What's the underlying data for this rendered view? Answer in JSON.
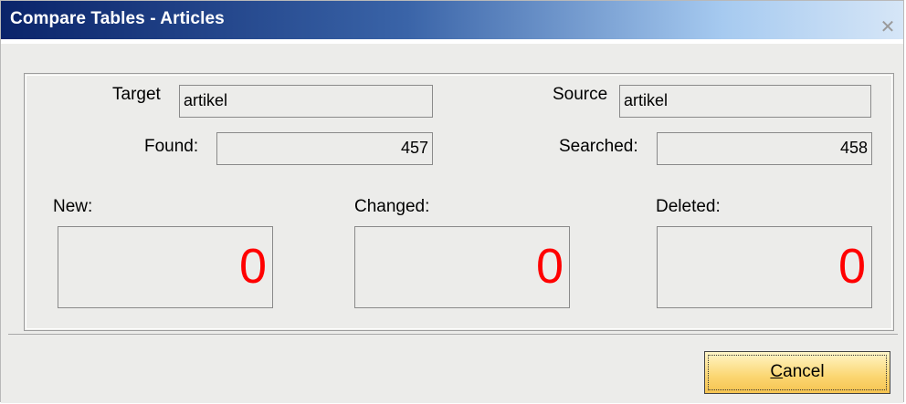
{
  "window": {
    "title": "Compare Tables - Articles"
  },
  "fields": {
    "target_label": "Target",
    "target_value": "artikel",
    "source_label": "Source",
    "source_value": "artikel",
    "found_label": "Found:",
    "found_value": "457",
    "searched_label": "Searched:",
    "searched_value": "458"
  },
  "counters": {
    "new_label": "New:",
    "new_value": "0",
    "changed_label": "Changed:",
    "changed_value": "0",
    "deleted_label": "Deleted:",
    "deleted_value": "0",
    "value_color": "#ff0000"
  },
  "buttons": {
    "cancel_mnemonic": "C",
    "cancel_rest": "ancel"
  },
  "icons": {
    "close": "close-icon"
  }
}
